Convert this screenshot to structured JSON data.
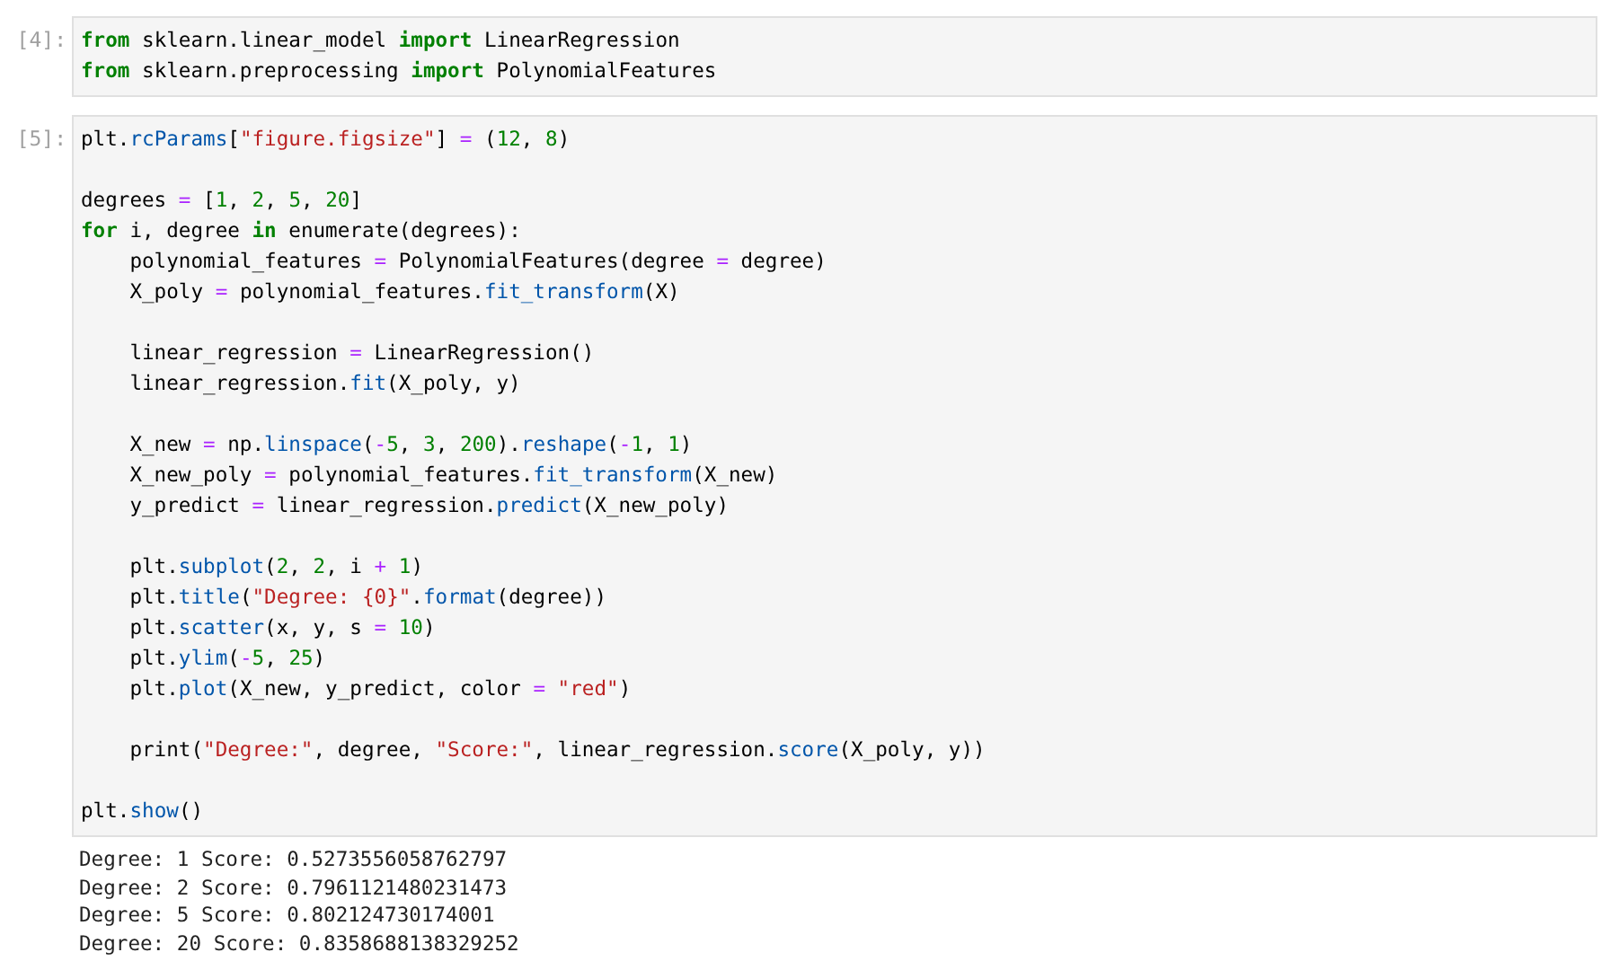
{
  "cells": [
    {
      "prompt": "[4]:",
      "paragraphs": [
        [
          [
            {
              "kind": "kw",
              "text": "from"
            },
            {
              "kind": "plain",
              "text": " sklearn.linear_model "
            },
            {
              "kind": "kw",
              "text": "import"
            },
            {
              "kind": "plain",
              "text": " LinearRegression"
            }
          ],
          [
            {
              "kind": "kw",
              "text": "from"
            },
            {
              "kind": "plain",
              "text": " sklearn.preprocessing "
            },
            {
              "kind": "kw",
              "text": "import"
            },
            {
              "kind": "plain",
              "text": " PolynomialFeatures"
            }
          ]
        ]
      ]
    },
    {
      "prompt": "[5]:",
      "paragraphs": [
        [
          [
            {
              "kind": "plain",
              "text": "plt."
            },
            {
              "kind": "attr",
              "text": "rcParams"
            },
            {
              "kind": "plain",
              "text": "["
            },
            {
              "kind": "str",
              "text": "\"figure.figsize\""
            },
            {
              "kind": "plain",
              "text": "] "
            },
            {
              "kind": "op",
              "text": "="
            },
            {
              "kind": "plain",
              "text": " ("
            },
            {
              "kind": "num",
              "text": "12"
            },
            {
              "kind": "plain",
              "text": ", "
            },
            {
              "kind": "num",
              "text": "8"
            },
            {
              "kind": "plain",
              "text": ")"
            }
          ]
        ],
        [
          [
            {
              "kind": "plain",
              "text": "degrees "
            },
            {
              "kind": "op",
              "text": "="
            },
            {
              "kind": "plain",
              "text": " ["
            },
            {
              "kind": "num",
              "text": "1"
            },
            {
              "kind": "plain",
              "text": ", "
            },
            {
              "kind": "num",
              "text": "2"
            },
            {
              "kind": "plain",
              "text": ", "
            },
            {
              "kind": "num",
              "text": "5"
            },
            {
              "kind": "plain",
              "text": ", "
            },
            {
              "kind": "num",
              "text": "20"
            },
            {
              "kind": "plain",
              "text": "]"
            }
          ],
          [
            {
              "kind": "kw",
              "text": "for"
            },
            {
              "kind": "plain",
              "text": " i, degree "
            },
            {
              "kind": "kw",
              "text": "in"
            },
            {
              "kind": "plain",
              "text": " enumerate(degrees):"
            }
          ],
          [
            {
              "kind": "plain",
              "text": "    polynomial_features "
            },
            {
              "kind": "op",
              "text": "="
            },
            {
              "kind": "plain",
              "text": " PolynomialFeatures(degree "
            },
            {
              "kind": "op",
              "text": "="
            },
            {
              "kind": "plain",
              "text": " degree)"
            }
          ],
          [
            {
              "kind": "plain",
              "text": "    X_poly "
            },
            {
              "kind": "op",
              "text": "="
            },
            {
              "kind": "plain",
              "text": " polynomial_features."
            },
            {
              "kind": "attr",
              "text": "fit_transform"
            },
            {
              "kind": "plain",
              "text": "(X)"
            }
          ]
        ],
        [
          [
            {
              "kind": "plain",
              "text": "    linear_regression "
            },
            {
              "kind": "op",
              "text": "="
            },
            {
              "kind": "plain",
              "text": " LinearRegression()"
            }
          ],
          [
            {
              "kind": "plain",
              "text": "    linear_regression."
            },
            {
              "kind": "attr",
              "text": "fit"
            },
            {
              "kind": "plain",
              "text": "(X_poly, y)"
            }
          ]
        ],
        [
          [
            {
              "kind": "plain",
              "text": "    X_new "
            },
            {
              "kind": "op",
              "text": "="
            },
            {
              "kind": "plain",
              "text": " np."
            },
            {
              "kind": "attr",
              "text": "linspace"
            },
            {
              "kind": "plain",
              "text": "("
            },
            {
              "kind": "op",
              "text": "-"
            },
            {
              "kind": "num",
              "text": "5"
            },
            {
              "kind": "plain",
              "text": ", "
            },
            {
              "kind": "num",
              "text": "3"
            },
            {
              "kind": "plain",
              "text": ", "
            },
            {
              "kind": "num",
              "text": "200"
            },
            {
              "kind": "plain",
              "text": ")."
            },
            {
              "kind": "attr",
              "text": "reshape"
            },
            {
              "kind": "plain",
              "text": "("
            },
            {
              "kind": "op",
              "text": "-"
            },
            {
              "kind": "num",
              "text": "1"
            },
            {
              "kind": "plain",
              "text": ", "
            },
            {
              "kind": "num",
              "text": "1"
            },
            {
              "kind": "plain",
              "text": ")"
            }
          ],
          [
            {
              "kind": "plain",
              "text": "    X_new_poly "
            },
            {
              "kind": "op",
              "text": "="
            },
            {
              "kind": "plain",
              "text": " polynomial_features."
            },
            {
              "kind": "attr",
              "text": "fit_transform"
            },
            {
              "kind": "plain",
              "text": "(X_new)"
            }
          ],
          [
            {
              "kind": "plain",
              "text": "    y_predict "
            },
            {
              "kind": "op",
              "text": "="
            },
            {
              "kind": "plain",
              "text": " linear_regression."
            },
            {
              "kind": "attr",
              "text": "predict"
            },
            {
              "kind": "plain",
              "text": "(X_new_poly)"
            }
          ]
        ],
        [
          [
            {
              "kind": "plain",
              "text": "    plt."
            },
            {
              "kind": "attr",
              "text": "subplot"
            },
            {
              "kind": "plain",
              "text": "("
            },
            {
              "kind": "num",
              "text": "2"
            },
            {
              "kind": "plain",
              "text": ", "
            },
            {
              "kind": "num",
              "text": "2"
            },
            {
              "kind": "plain",
              "text": ", i "
            },
            {
              "kind": "op",
              "text": "+ "
            },
            {
              "kind": "num",
              "text": "1"
            },
            {
              "kind": "plain",
              "text": ")"
            }
          ],
          [
            {
              "kind": "plain",
              "text": "    plt."
            },
            {
              "kind": "attr",
              "text": "title"
            },
            {
              "kind": "plain",
              "text": "("
            },
            {
              "kind": "str",
              "text": "\"Degree: {0}\""
            },
            {
              "kind": "plain",
              "text": "."
            },
            {
              "kind": "attr",
              "text": "format"
            },
            {
              "kind": "plain",
              "text": "(degree))"
            }
          ],
          [
            {
              "kind": "plain",
              "text": "    plt."
            },
            {
              "kind": "attr",
              "text": "scatter"
            },
            {
              "kind": "plain",
              "text": "(x, y, s "
            },
            {
              "kind": "op",
              "text": "= "
            },
            {
              "kind": "num",
              "text": "10"
            },
            {
              "kind": "plain",
              "text": ")"
            }
          ],
          [
            {
              "kind": "plain",
              "text": "    plt."
            },
            {
              "kind": "attr",
              "text": "ylim"
            },
            {
              "kind": "plain",
              "text": "("
            },
            {
              "kind": "op",
              "text": "-"
            },
            {
              "kind": "num",
              "text": "5"
            },
            {
              "kind": "plain",
              "text": ", "
            },
            {
              "kind": "num",
              "text": "25"
            },
            {
              "kind": "plain",
              "text": ")"
            }
          ],
          [
            {
              "kind": "plain",
              "text": "    plt."
            },
            {
              "kind": "attr",
              "text": "plot"
            },
            {
              "kind": "plain",
              "text": "(X_new, y_predict, color "
            },
            {
              "kind": "op",
              "text": "= "
            },
            {
              "kind": "str",
              "text": "\"red\""
            },
            {
              "kind": "plain",
              "text": ")"
            }
          ]
        ],
        [
          [
            {
              "kind": "plain",
              "text": "    print("
            },
            {
              "kind": "str",
              "text": "\"Degree:\""
            },
            {
              "kind": "plain",
              "text": ", degree, "
            },
            {
              "kind": "str",
              "text": "\"Score:\""
            },
            {
              "kind": "plain",
              "text": ", linear_regression."
            },
            {
              "kind": "attr",
              "text": "score"
            },
            {
              "kind": "plain",
              "text": "(X_poly, y))"
            }
          ]
        ],
        [
          [
            {
              "kind": "plain",
              "text": "plt."
            },
            {
              "kind": "attr",
              "text": "show"
            },
            {
              "kind": "plain",
              "text": "()"
            }
          ]
        ]
      ],
      "output": [
        "Degree: 1 Score: 0.5273556058762797",
        "Degree: 2 Score: 0.7961121480231473",
        "Degree: 5 Score: 0.802124730174001",
        "Degree: 20 Score: 0.8358688138329252"
      ]
    }
  ]
}
